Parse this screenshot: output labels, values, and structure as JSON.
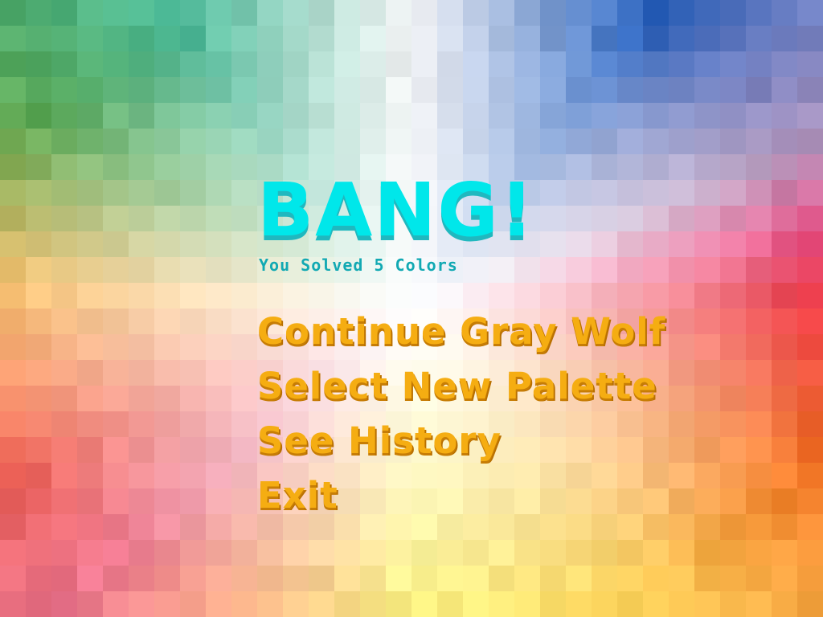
{
  "title": "BANG!",
  "subtitle": "You Solved 5 Colors",
  "menu": {
    "continue_label": "Continue Gray Wolf",
    "select_palette_label": "Select New Palette",
    "history_label": "See History",
    "exit_label": "Exit"
  },
  "colors": {
    "title": "#00e7ea",
    "title_shadow": "#20b8bf",
    "subtitle": "#12a9b3",
    "menu": "#f5ad12",
    "menu_shadow": "#c77d05"
  }
}
